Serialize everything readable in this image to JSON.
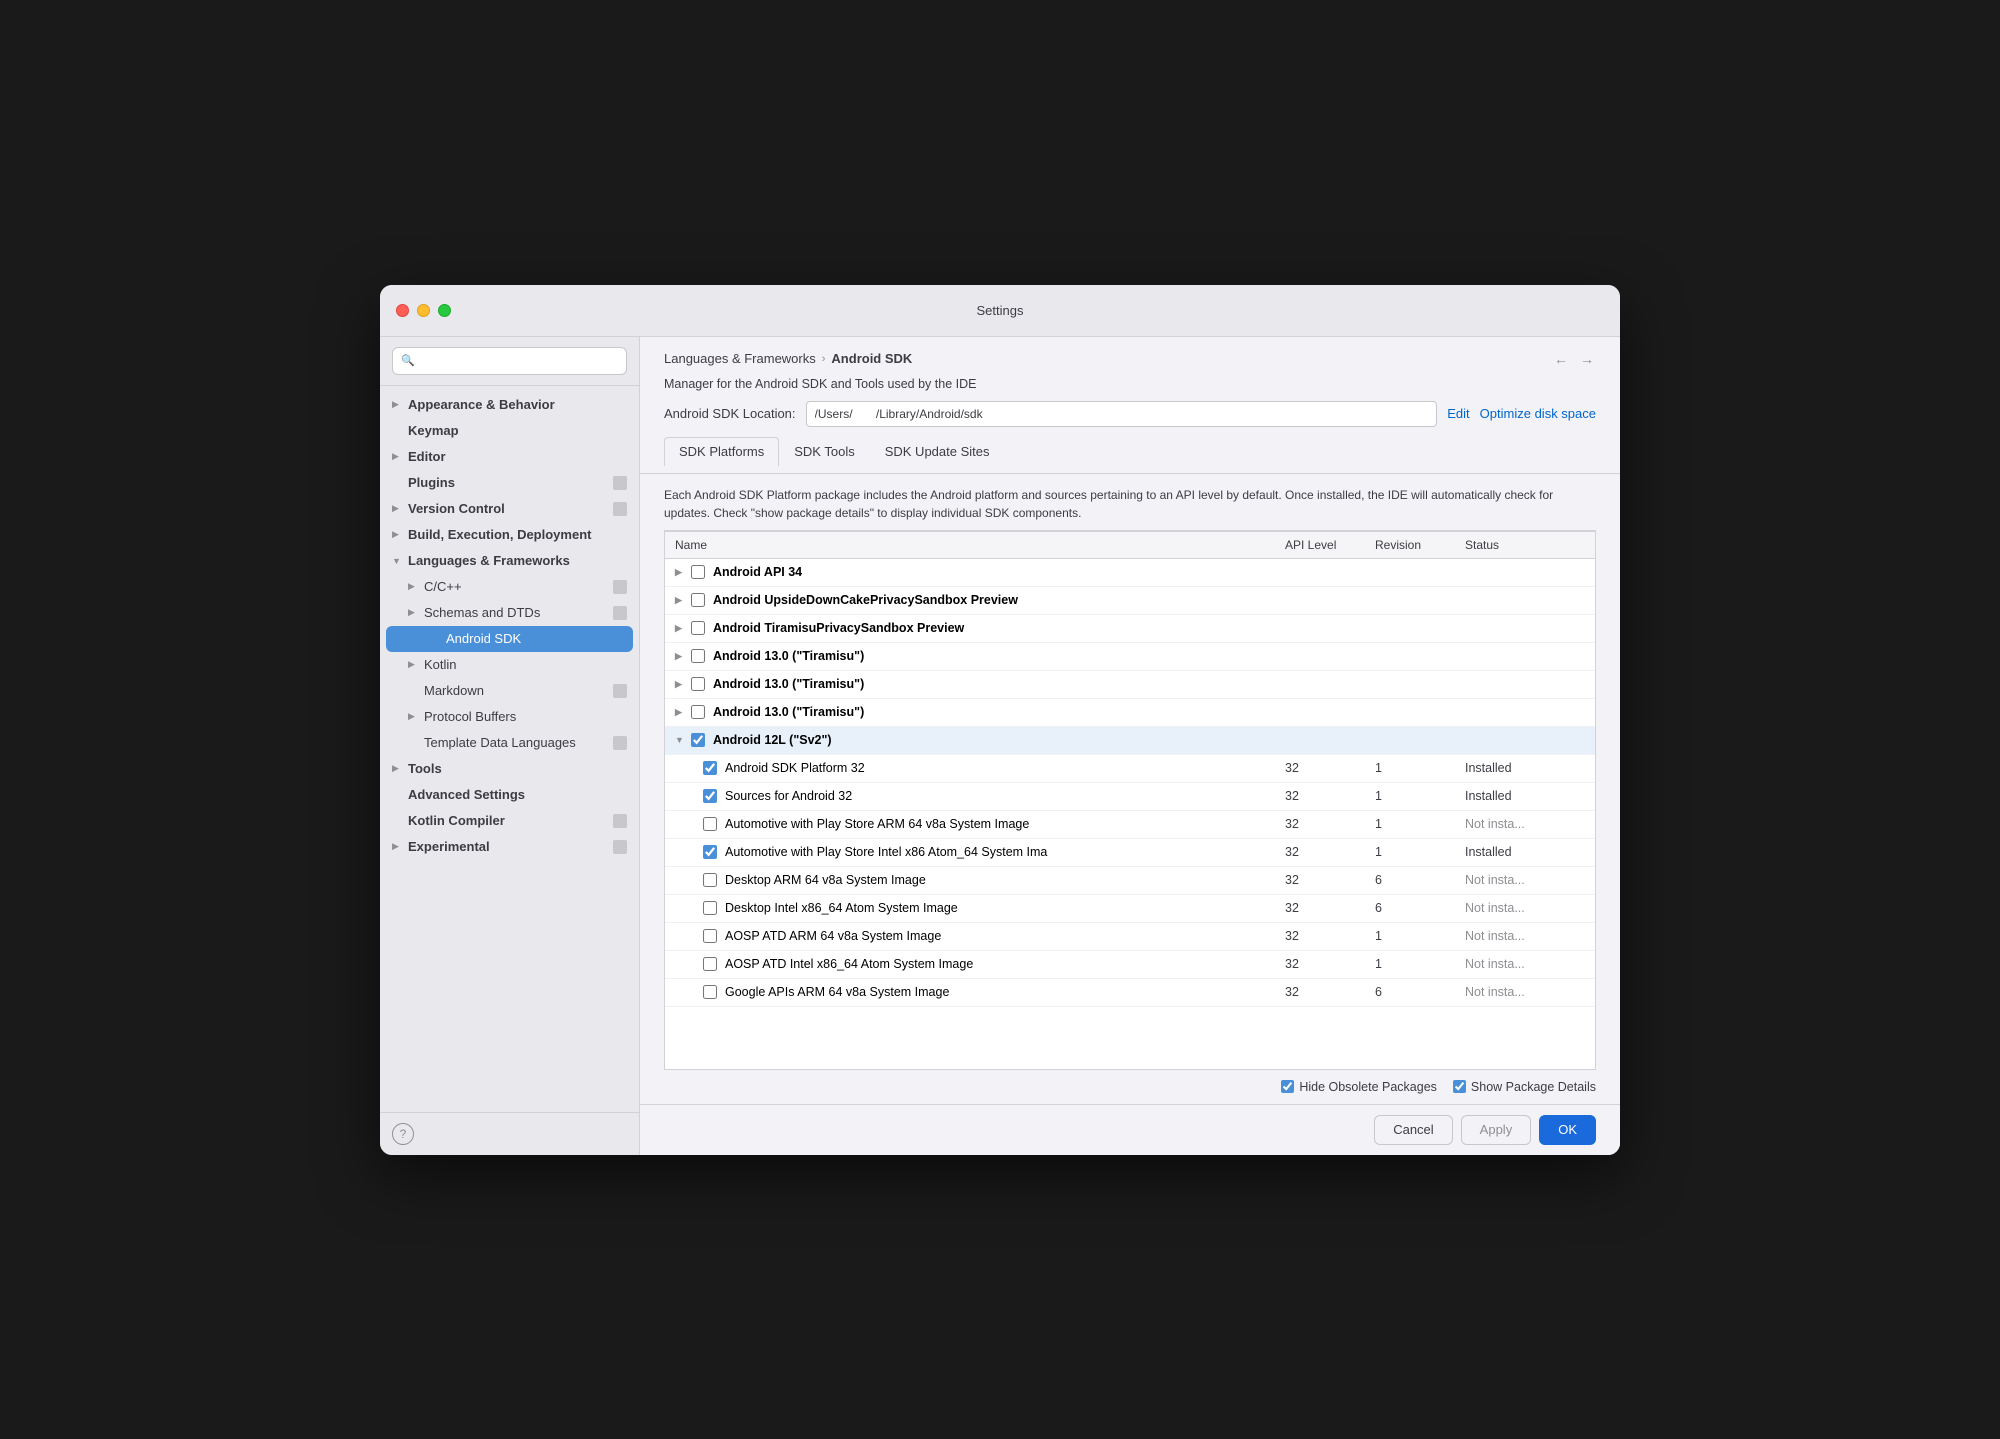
{
  "window": {
    "title": "Settings"
  },
  "sidebar": {
    "search_placeholder": "🔍",
    "items": [
      {
        "id": "appearance",
        "label": "Appearance & Behavior",
        "bold": true,
        "indent": 0,
        "has_chevron": true,
        "chevron_open": false,
        "has_badge": false
      },
      {
        "id": "keymap",
        "label": "Keymap",
        "bold": true,
        "indent": 0,
        "has_chevron": false,
        "has_badge": false
      },
      {
        "id": "editor",
        "label": "Editor",
        "bold": true,
        "indent": 0,
        "has_chevron": true,
        "chevron_open": false,
        "has_badge": false
      },
      {
        "id": "plugins",
        "label": "Plugins",
        "bold": true,
        "indent": 0,
        "has_chevron": false,
        "has_badge": true
      },
      {
        "id": "version-control",
        "label": "Version Control",
        "bold": true,
        "indent": 0,
        "has_chevron": true,
        "chevron_open": false,
        "has_badge": true
      },
      {
        "id": "build-execution",
        "label": "Build, Execution, Deployment",
        "bold": true,
        "indent": 0,
        "has_chevron": true,
        "chevron_open": false,
        "has_badge": false
      },
      {
        "id": "languages-frameworks",
        "label": "Languages & Frameworks",
        "bold": true,
        "indent": 0,
        "has_chevron": true,
        "chevron_open": true,
        "has_badge": false
      },
      {
        "id": "cpp",
        "label": "C/C++",
        "bold": false,
        "indent": 1,
        "has_chevron": true,
        "chevron_open": false,
        "has_badge": true
      },
      {
        "id": "schemas-dtds",
        "label": "Schemas and DTDs",
        "bold": false,
        "indent": 1,
        "has_chevron": true,
        "chevron_open": false,
        "has_badge": true
      },
      {
        "id": "android-sdk",
        "label": "Android SDK",
        "bold": false,
        "indent": 2,
        "has_chevron": false,
        "has_badge": false,
        "selected": true
      },
      {
        "id": "kotlin",
        "label": "Kotlin",
        "bold": false,
        "indent": 1,
        "has_chevron": true,
        "chevron_open": false,
        "has_badge": false
      },
      {
        "id": "markdown",
        "label": "Markdown",
        "bold": false,
        "indent": 1,
        "has_chevron": false,
        "has_badge": true
      },
      {
        "id": "protocol-buffers",
        "label": "Protocol Buffers",
        "bold": false,
        "indent": 1,
        "has_chevron": true,
        "chevron_open": false,
        "has_badge": false
      },
      {
        "id": "template-data-languages",
        "label": "Template Data Languages",
        "bold": false,
        "indent": 1,
        "has_chevron": false,
        "has_badge": true
      },
      {
        "id": "tools",
        "label": "Tools",
        "bold": true,
        "indent": 0,
        "has_chevron": true,
        "chevron_open": false,
        "has_badge": false
      },
      {
        "id": "advanced-settings",
        "label": "Advanced Settings",
        "bold": true,
        "indent": 0,
        "has_chevron": false,
        "has_badge": false
      },
      {
        "id": "kotlin-compiler",
        "label": "Kotlin Compiler",
        "bold": true,
        "indent": 0,
        "has_chevron": false,
        "has_badge": true
      },
      {
        "id": "experimental",
        "label": "Experimental",
        "bold": true,
        "indent": 0,
        "has_chevron": true,
        "chevron_open": false,
        "has_badge": true
      }
    ]
  },
  "header": {
    "breadcrumb_parent": "Languages & Frameworks",
    "breadcrumb_separator": "›",
    "breadcrumb_current": "Android SDK",
    "description": "Manager for the Android SDK and Tools used by the IDE",
    "sdk_location_label": "Android SDK Location:",
    "sdk_location_value": "/Users/       /Library/Android/sdk",
    "edit_label": "Edit",
    "optimize_label": "Optimize disk space"
  },
  "tabs": [
    {
      "id": "sdk-platforms",
      "label": "SDK Platforms",
      "active": true
    },
    {
      "id": "sdk-tools",
      "label": "SDK Tools",
      "active": false
    },
    {
      "id": "sdk-update-sites",
      "label": "SDK Update Sites",
      "active": false
    }
  ],
  "table": {
    "info_text": "Each Android SDK Platform package includes the Android platform and sources pertaining to an API level by default. Once installed, the IDE will automatically check for updates. Check \"show package details\" to display individual SDK components.",
    "columns": [
      "Name",
      "API Level",
      "Revision",
      "Status"
    ],
    "rows": [
      {
        "id": "api34",
        "indent": 1,
        "has_chevron": true,
        "chevron_open": false,
        "checkbox_state": "unchecked",
        "name": "Android API 34",
        "api": "",
        "revision": "",
        "status": "",
        "bold": true
      },
      {
        "id": "upsidedown",
        "indent": 1,
        "has_chevron": true,
        "chevron_open": false,
        "checkbox_state": "unchecked",
        "name": "Android UpsideDownCakePrivacySandbox Preview",
        "api": "",
        "revision": "",
        "status": "",
        "bold": true
      },
      {
        "id": "tiramisu-privacy",
        "indent": 1,
        "has_chevron": true,
        "chevron_open": false,
        "checkbox_state": "unchecked",
        "name": "Android TiramisuPrivacySandbox Preview",
        "api": "",
        "revision": "",
        "status": "",
        "bold": true
      },
      {
        "id": "android13-a",
        "indent": 1,
        "has_chevron": true,
        "chevron_open": false,
        "checkbox_state": "partial",
        "name": "Android 13.0 (\"Tiramisu\")",
        "api": "",
        "revision": "",
        "status": "",
        "bold": true
      },
      {
        "id": "android13-b",
        "indent": 1,
        "has_chevron": true,
        "chevron_open": false,
        "checkbox_state": "unchecked",
        "name": "Android 13.0 (\"Tiramisu\")",
        "api": "",
        "revision": "",
        "status": "",
        "bold": true
      },
      {
        "id": "android13-c",
        "indent": 1,
        "has_chevron": true,
        "chevron_open": false,
        "checkbox_state": "unchecked",
        "name": "Android 13.0 (\"Tiramisu\")",
        "api": "",
        "revision": "",
        "status": "",
        "bold": true
      },
      {
        "id": "android12l",
        "indent": 1,
        "has_chevron": true,
        "chevron_open": true,
        "checkbox_state": "partial",
        "name": "Android 12L (\"Sv2\")",
        "api": "",
        "revision": "",
        "status": "",
        "bold": true
      },
      {
        "id": "sdk-platform-32",
        "indent": 2,
        "has_chevron": false,
        "checkbox_state": "checked",
        "name": "Android SDK Platform 32",
        "api": "32",
        "revision": "1",
        "status": "Installed",
        "bold": false
      },
      {
        "id": "sources-32",
        "indent": 2,
        "has_chevron": false,
        "checkbox_state": "checked",
        "name": "Sources for Android 32",
        "api": "32",
        "revision": "1",
        "status": "Installed",
        "bold": false
      },
      {
        "id": "automotive-arm",
        "indent": 2,
        "has_chevron": false,
        "checkbox_state": "unchecked",
        "name": "Automotive with Play Store ARM 64 v8a System Image",
        "api": "32",
        "revision": "1",
        "status": "Not insta...",
        "bold": false
      },
      {
        "id": "automotive-intel",
        "indent": 2,
        "has_chevron": false,
        "checkbox_state": "checked",
        "name": "Automotive with Play Store Intel x86 Atom_64 System Ima",
        "api": "32",
        "revision": "1",
        "status": "Installed",
        "bold": false
      },
      {
        "id": "desktop-arm",
        "indent": 2,
        "has_chevron": false,
        "checkbox_state": "unchecked",
        "name": "Desktop ARM 64 v8a System Image",
        "api": "32",
        "revision": "6",
        "status": "Not insta...",
        "bold": false
      },
      {
        "id": "desktop-intel",
        "indent": 2,
        "has_chevron": false,
        "checkbox_state": "unchecked",
        "name": "Desktop Intel x86_64 Atom System Image",
        "api": "32",
        "revision": "6",
        "status": "Not insta...",
        "bold": false
      },
      {
        "id": "aosp-atd-arm",
        "indent": 2,
        "has_chevron": false,
        "checkbox_state": "unchecked",
        "name": "AOSP ATD ARM 64 v8a System Image",
        "api": "32",
        "revision": "1",
        "status": "Not insta...",
        "bold": false
      },
      {
        "id": "aosp-atd-intel",
        "indent": 2,
        "has_chevron": false,
        "checkbox_state": "unchecked",
        "name": "AOSP ATD Intel x86_64 Atom System Image",
        "api": "32",
        "revision": "1",
        "status": "Not insta...",
        "bold": false
      },
      {
        "id": "google-apis-arm",
        "indent": 2,
        "has_chevron": false,
        "checkbox_state": "unchecked",
        "name": "Google APIs ARM 64 v8a System Image",
        "api": "32",
        "revision": "6",
        "status": "Not insta...",
        "bold": false
      }
    ]
  },
  "footer": {
    "hide_obsolete_label": "Hide Obsolete Packages",
    "show_package_label": "Show Package Details",
    "hide_obsolete_checked": true,
    "show_package_checked": true
  },
  "buttons": {
    "cancel": "Cancel",
    "apply": "Apply",
    "ok": "OK"
  }
}
